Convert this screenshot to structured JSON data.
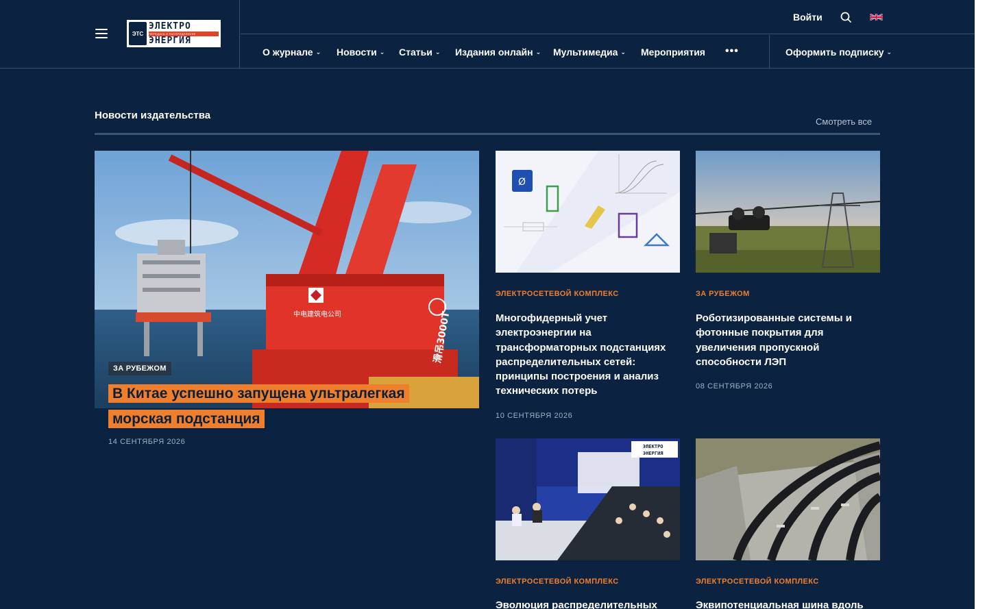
{
  "header": {
    "logo": {
      "mark": "ЭТС",
      "line1": "ЭЛЕКТРО",
      "stripe": "ПЕРЕДАЧА И РАСПРЕДЕЛЕНИЕ",
      "line2": "ЭНЕРГИЯ"
    },
    "login_label": "Войти",
    "nav": [
      {
        "label": "О журнале",
        "has_dropdown": true
      },
      {
        "label": "Новости",
        "has_dropdown": true
      },
      {
        "label": "Статьи",
        "has_dropdown": true
      },
      {
        "label": "Издания онлайн",
        "has_dropdown": true
      },
      {
        "label": "Мультимедиа",
        "has_dropdown": true
      },
      {
        "label": "Мероприятия",
        "has_dropdown": false
      }
    ],
    "more_label": "•••",
    "subscribe_label": "Оформить подписку",
    "icons": {
      "menu": "hamburger-icon",
      "search": "search-icon",
      "language": "uk-flag-icon",
      "dropdown": "chevron-down-icon"
    }
  },
  "section": {
    "title": "Новости издательства",
    "see_all": "Смотреть все"
  },
  "featured": {
    "tag": "ЗА РУБЕЖОМ",
    "title": "В Китае успешно запущена ультралегкая морская подстанция",
    "date": "14 СЕНТЯБРЯ 2026",
    "image": "offshore-crane-platform"
  },
  "cards": [
    {
      "category": "ЭЛЕКТРОСЕТЕВОЙ КОМПЛЕКС",
      "title": "Многофидерный учет электроэнергии на трансформаторных подстанциях распределительных сетей: принципы построения и анализ технических потерь",
      "date": "10 СЕНТЯБРЯ 2026",
      "image": "electrical-schematic-illustration"
    },
    {
      "category": "ЗА РУБЕЖОМ",
      "title": "Роботизированные системы и фотонные покрытия для увеличения пропускной способности ЛЭП",
      "date": "08 СЕНТЯБРЯ 2026",
      "image": "power-line-robot"
    },
    {
      "category": "ЭЛЕКТРОСЕТЕВОЙ КОМПЛЕКС",
      "title": "Эволюция распределительных",
      "date": "",
      "image": "conference-hall"
    },
    {
      "category": "ЭЛЕКТРОСЕТЕВОЙ КОМПЛЕКС",
      "title": "Эквипотенциальная шина вдоль",
      "date": "",
      "image": "cable-trench"
    }
  ],
  "colors": {
    "background": "#0b2340",
    "accent": "#f07f2d",
    "divider": "#3a5272",
    "muted": "#9fb0c4"
  }
}
